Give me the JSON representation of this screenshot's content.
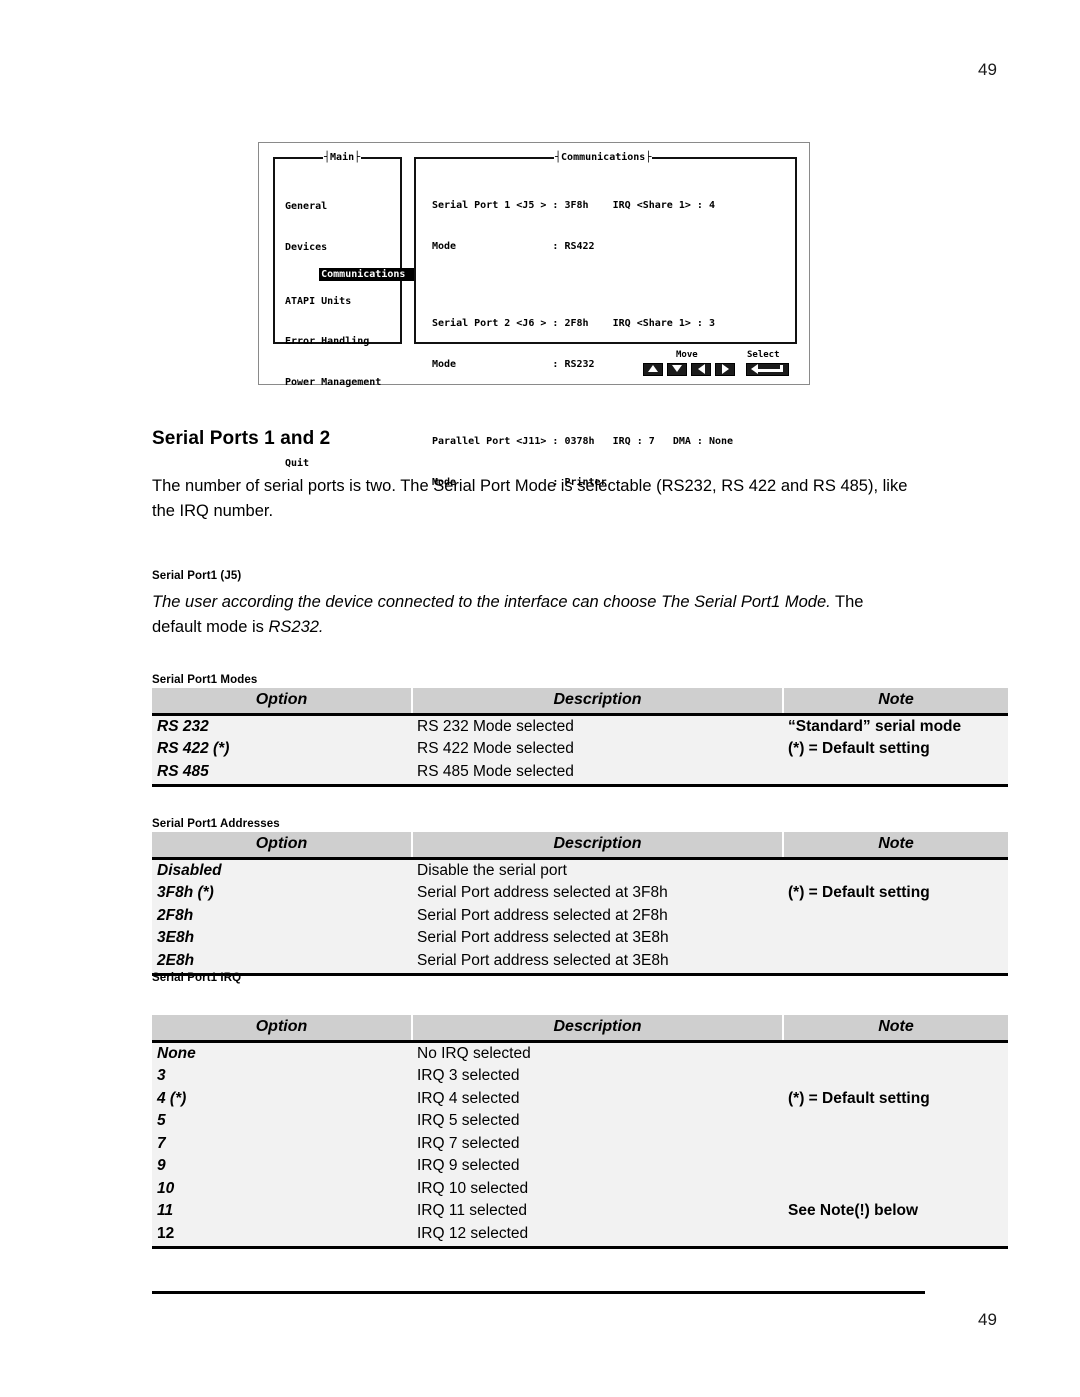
{
  "page": {
    "number_top": "49",
    "number_bottom": "49"
  },
  "bios_screen": {
    "main_panel": {
      "title": "Main",
      "items": [
        {
          "label": "General",
          "selected": false
        },
        {
          "label": "Devices",
          "selected": false
        },
        {
          "label": "Communications",
          "selected": true
        },
        {
          "label": "ATAPI Units",
          "selected": false
        },
        {
          "label": "Error Handling",
          "selected": false
        },
        {
          "label": "Power Management",
          "selected": false
        }
      ],
      "quit_label": "Quit"
    },
    "comm_panel": {
      "title": "Communications",
      "lines": [
        "Serial Port 1 <J5 > : 3F8h    IRQ <Share 1> : 4",
        "Mode                : RS422",
        "",
        "Serial Port 2 <J6 > : 2F8h    IRQ <Share 1> : 3",
        "Mode                : RS232",
        "",
        "Parallel Port <J11> : 0378h   IRQ : 7   DMA : None",
        "Mode                : Printer"
      ]
    },
    "key_hints": {
      "move_label": "Move",
      "select_label": "Select",
      "keys": [
        "arrow-up",
        "arrow-down",
        "arrow-left",
        "arrow-right",
        "enter"
      ]
    }
  },
  "content": {
    "section_heading": "Serial Ports 1 and 2",
    "intro_paragraph": "The number of serial ports is two. The Serial Port Mode is selectable (RS232, RS 422 and RS 485), like the IRQ number.",
    "subsection_label": "Serial Port1 (J5)",
    "subsection_text_italic_1": "The user according the device connected to the interface can choose The Serial Port1 Mode.",
    "subsection_text_upright_1": " The default mode is ",
    "subsection_text_italic_2": "RS232."
  },
  "tables": {
    "headers": {
      "option": "Option",
      "description": "Description",
      "note": "Note"
    },
    "modes": {
      "caption": "Serial Port1 Modes",
      "rows": [
        {
          "option": "RS 232",
          "description": "RS 232 Mode selected",
          "note": "“Standard” serial mode"
        },
        {
          "option": "RS 422 (*)",
          "description": "RS 422 Mode selected",
          "note": "(*) = Default setting"
        },
        {
          "option": "RS 485",
          "description": "RS 485 Mode selected",
          "note": ""
        }
      ]
    },
    "addresses": {
      "caption": "Serial Port1 Addresses",
      "rows": [
        {
          "option": "Disabled",
          "description": "Disable the serial port",
          "note": ""
        },
        {
          "option": "3F8h (*)",
          "description": "Serial Port address selected at 3F8h",
          "note": "(*) = Default setting"
        },
        {
          "option": "2F8h",
          "description": "Serial Port address selected at 2F8h",
          "note": ""
        },
        {
          "option": "3E8h",
          "description": "Serial Port address selected at 3E8h",
          "note": ""
        },
        {
          "option": "2E8h",
          "description": "Serial Port address selected at 3E8h",
          "note": ""
        }
      ]
    },
    "irq": {
      "caption": "Serial Port1 IRQ",
      "rows": [
        {
          "option": "None",
          "description": "No IRQ selected",
          "note": ""
        },
        {
          "option": "3",
          "description": "IRQ 3 selected",
          "note": ""
        },
        {
          "option": "4 (*)",
          "description": "IRQ 4 selected",
          "note": "(*) = Default setting"
        },
        {
          "option": "5",
          "description": "IRQ 5 selected",
          "note": ""
        },
        {
          "option": "7",
          "description": "IRQ 7 selected",
          "note": ""
        },
        {
          "option": "9",
          "description": "IRQ 9 selected",
          "note": ""
        },
        {
          "option": "10",
          "description": "IRQ 10 selected",
          "note": ""
        },
        {
          "option": "11",
          "description": "IRQ 11 selected",
          "note": "See Note(!) below"
        },
        {
          "option": "12",
          "description": "IRQ 12 selected",
          "note": ""
        }
      ]
    }
  }
}
